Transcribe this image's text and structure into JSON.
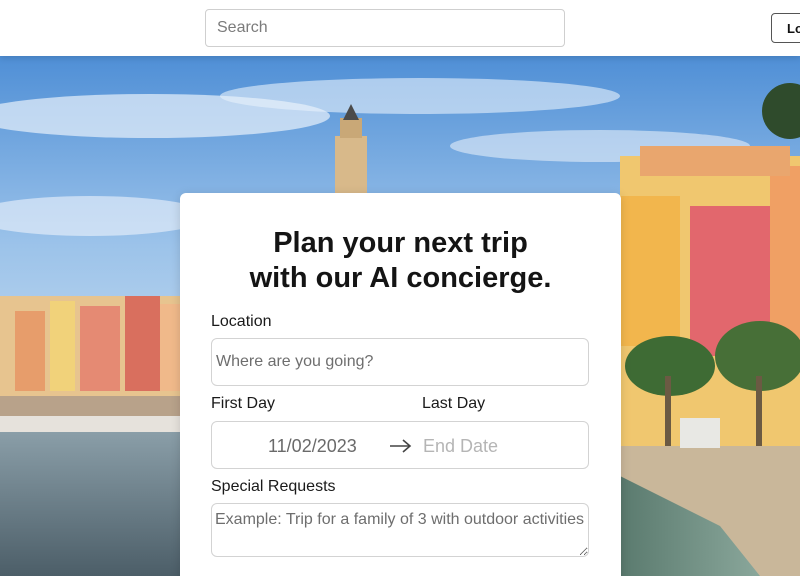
{
  "header": {
    "search_placeholder": "Search",
    "login_label": "Lo"
  },
  "card": {
    "title_line1": "Plan your next trip",
    "title_line2": "with our AI concierge.",
    "location_label": "Location",
    "location_placeholder": "Where are you going?",
    "first_day_label": "First Day",
    "last_day_label": "Last Day",
    "start_date": "11/02/2023",
    "end_date_placeholder": "End Date",
    "special_requests_label": "Special Requests",
    "special_requests_placeholder": "Example: Trip for a family of 3 with outdoor activities"
  },
  "colors": {
    "sky": "#7fb2e6",
    "water": "#6b7f8a",
    "sand": "#c9b79a",
    "card_bg": "#ffffff"
  }
}
